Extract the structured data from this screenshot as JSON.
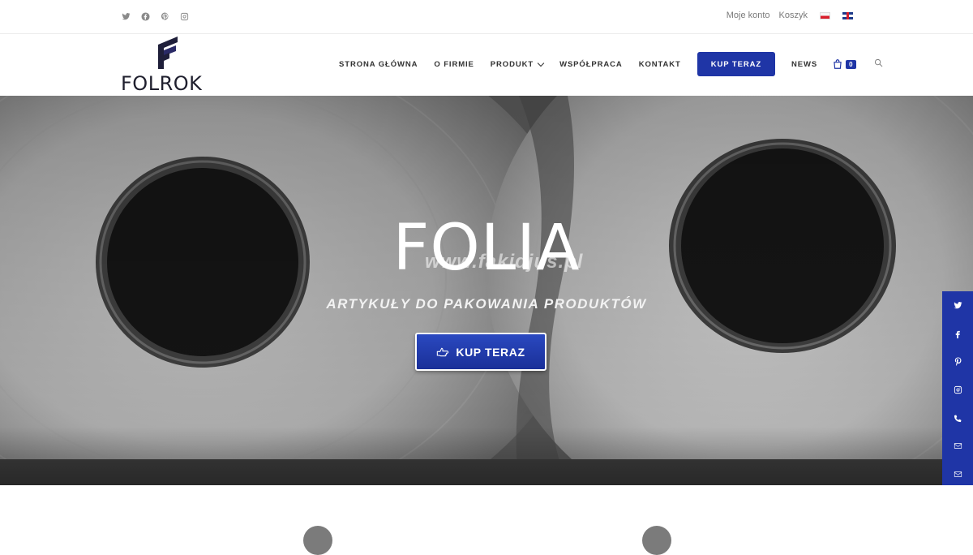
{
  "topbar": {
    "social_icons": [
      "twitter-icon",
      "facebook-icon",
      "pinterest-icon",
      "instagram-icon"
    ],
    "my_account": "Moje konto",
    "cart": "Koszyk",
    "languages": [
      "pl-flag-icon",
      "gb-flag-icon"
    ]
  },
  "header": {
    "logo_text": "FOLROK",
    "nav": [
      {
        "label": "STRONA GŁÓWNA"
      },
      {
        "label": "O FIRMIE"
      },
      {
        "label": "PRODUKT"
      },
      {
        "label": "WSPÓŁPRACA"
      },
      {
        "label": "KONTAKT"
      },
      {
        "label": "KUP TERAZ"
      },
      {
        "label": "NEWS"
      }
    ],
    "cart_count": "0"
  },
  "hero": {
    "title": "FOLIA",
    "watermark": "www.fakidjus.pl",
    "subtitle": "ARTYKUŁY DO PAKOWANIA PRODUKTÓW",
    "button_label": "KUP TERAZ"
  },
  "side_social": [
    "twitter-icon",
    "facebook-icon",
    "pinterest-icon",
    "instagram-icon",
    "phone-icon",
    "envelope-icon",
    "envelope-icon"
  ],
  "colors": {
    "accent": "#1f35a6",
    "text_dark": "#333333",
    "top_text": "#7a7a7a"
  }
}
